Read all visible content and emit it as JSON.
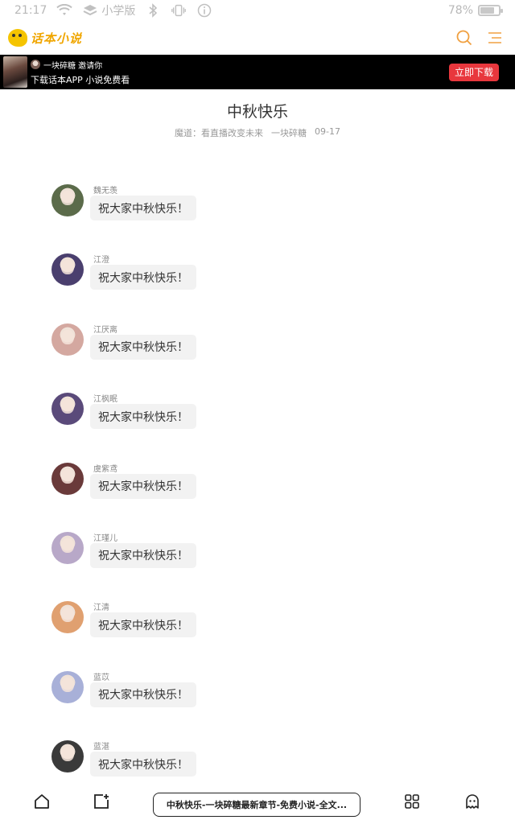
{
  "status_bar": {
    "time": "21:17",
    "mode_label": "小学版",
    "battery_text": "78%",
    "battery_level": 0.78
  },
  "header": {
    "logo_text": "话本小说",
    "icons": [
      "search-icon",
      "menu-icon"
    ]
  },
  "banner": {
    "inviter_text": "一块碎糖 邀请你",
    "tagline": "下载话本APP 小说免费看",
    "download_label": "立即下载",
    "accent_color": "#e8373d"
  },
  "chapter": {
    "title": "中秋快乐",
    "book": "魔道：看直播改变未来",
    "author": "一块碎糖",
    "date": "09-17"
  },
  "messages": [
    {
      "sender": "魏无羡",
      "text": "祝大家中秋快乐！",
      "avatar_color": "#5b6b4a"
    },
    {
      "sender": "江澄",
      "text": "祝大家中秋快乐！",
      "avatar_color": "#4a3f6e"
    },
    {
      "sender": "江厌离",
      "text": "祝大家中秋快乐！",
      "avatar_color": "#d4a8a0"
    },
    {
      "sender": "江枫眠",
      "text": "祝大家中秋快乐！",
      "avatar_color": "#5a4a7a"
    },
    {
      "sender": "虞紫鸢",
      "text": "祝大家中秋快乐！",
      "avatar_color": "#6a3a3a"
    },
    {
      "sender": "江瑾儿",
      "text": "祝大家中秋快乐！",
      "avatar_color": "#b8a8c8"
    },
    {
      "sender": "江清",
      "text": "祝大家中秋快乐！",
      "avatar_color": "#e0a070"
    },
    {
      "sender": "蓝苡",
      "text": "祝大家中秋快乐！",
      "avatar_color": "#a8b0d8"
    },
    {
      "sender": "蓝湛",
      "text": "祝大家中秋快乐！",
      "avatar_color": "#3a3a3a"
    }
  ],
  "bottom_nav": {
    "page_title": "中秋快乐-一块碎糖最新章节-免费小说-全文...",
    "icons": [
      "home-icon",
      "tabs-icon",
      "apps-icon",
      "ghost-icon"
    ]
  }
}
